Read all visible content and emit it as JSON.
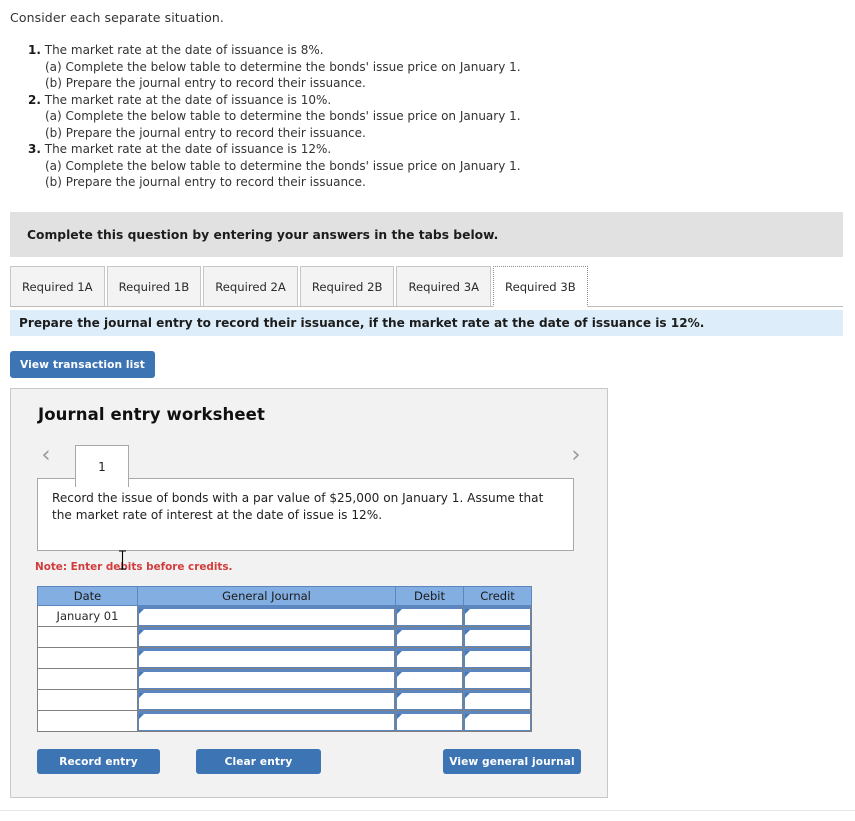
{
  "intro": "Consider each separate situation.",
  "questions": [
    {
      "num": "1.",
      "text": "The market rate at the date of issuance is 8%.",
      "sub_a": "(a) Complete the below table to determine the bonds' issue price on January 1.",
      "sub_b": "(b) Prepare the journal entry to record their issuance."
    },
    {
      "num": "2.",
      "text": "The market rate at the date of issuance is 10%.",
      "sub_a": "(a) Complete the below table to determine the bonds' issue price on January 1.",
      "sub_b": "(b) Prepare the journal entry to record their issuance."
    },
    {
      "num": "3.",
      "text": "The market rate at the date of issuance is 12%.",
      "sub_a": "(a) Complete the below table to determine the bonds' issue price on January 1.",
      "sub_b": "(b) Prepare the journal entry to record their issuance."
    }
  ],
  "instruction_bar": {
    "text": "Complete this question by entering your answers in the tabs below."
  },
  "tabs": [
    {
      "label": "Required 1A",
      "active": false
    },
    {
      "label": "Required 1B",
      "active": false
    },
    {
      "label": "Required 2A",
      "active": false
    },
    {
      "label": "Required 2B",
      "active": false
    },
    {
      "label": "Required 3A",
      "active": false
    },
    {
      "label": "Required 3B",
      "active": true
    }
  ],
  "sub_instruction": {
    "text": "Prepare the journal entry to record their issuance, if the market rate at the date of issuance is 12%."
  },
  "buttons": {
    "view_transaction_list": "View transaction list",
    "record_entry": "Record entry",
    "clear_entry": "Clear entry",
    "view_general_journal": "View general journal"
  },
  "worksheet": {
    "title": "Journal entry worksheet",
    "prev_icon": "chevron-left-icon",
    "next_icon": "chevron-right-icon",
    "page_tabs": [
      {
        "label": "1",
        "active": true
      }
    ],
    "description": "Record the issue of bonds with a par value of $25,000 on January 1. Assume that the market rate of interest at the date of issue is 12%.",
    "note": "Note: Enter debits before credits."
  },
  "journal_table": {
    "headers": [
      "Date",
      "General Journal",
      "Debit",
      "Credit"
    ],
    "rows": [
      {
        "date": "January 01",
        "general_journal": "",
        "debit": "",
        "credit": ""
      },
      {
        "date": "",
        "general_journal": "",
        "debit": "",
        "credit": ""
      },
      {
        "date": "",
        "general_journal": "",
        "debit": "",
        "credit": ""
      },
      {
        "date": "",
        "general_journal": "",
        "debit": "",
        "credit": ""
      },
      {
        "date": "",
        "general_journal": "",
        "debit": "",
        "credit": ""
      },
      {
        "date": "",
        "general_journal": "",
        "debit": "",
        "credit": ""
      }
    ]
  },
  "colors": {
    "button_blue": "#3c74b4",
    "table_header_blue": "#82aee2",
    "sub_instruction_blue": "#ddeefa",
    "instruction_grey": "#e1e1e1",
    "panel_grey": "#f2f2f2",
    "note_red": "#d23c3c"
  }
}
